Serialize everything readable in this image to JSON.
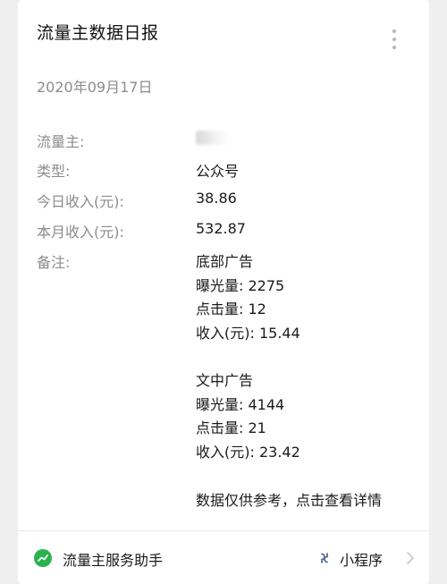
{
  "card": {
    "title": "流量主数据日报",
    "date": "2020年09月17日"
  },
  "rows": [
    {
      "label": "流量主:",
      "value": ""
    },
    {
      "label": "类型:",
      "value": "公众号"
    },
    {
      "label": "今日收入(元):",
      "value": "38.86"
    },
    {
      "label": "本月收入(元):",
      "value": "532.87"
    },
    {
      "label": "备注:",
      "value": ""
    }
  ],
  "notes": {
    "bottom_ad": {
      "title": "底部广告",
      "impressions": "曝光量: 2275",
      "clicks": "点击量: 12",
      "income": "收入(元): 15.44"
    },
    "in_article_ad": {
      "title": "文中广告",
      "impressions": "曝光量: 4144",
      "clicks": "点击量: 21",
      "income": "收入(元): 23.42"
    },
    "disclaimer": "数据仅供参考，点击查看详情"
  },
  "footer": {
    "service_name": "流量主服务助手",
    "mini_program_label": "小程序",
    "service_icon": "chart-icon",
    "mini_program_icon": "mini-program-icon"
  },
  "colors": {
    "background": "#efefef",
    "card": "#ffffff",
    "label_gray": "#8c8c8c",
    "service_green": "#2ab24f",
    "mini_program_blue": "#5b6e96"
  }
}
